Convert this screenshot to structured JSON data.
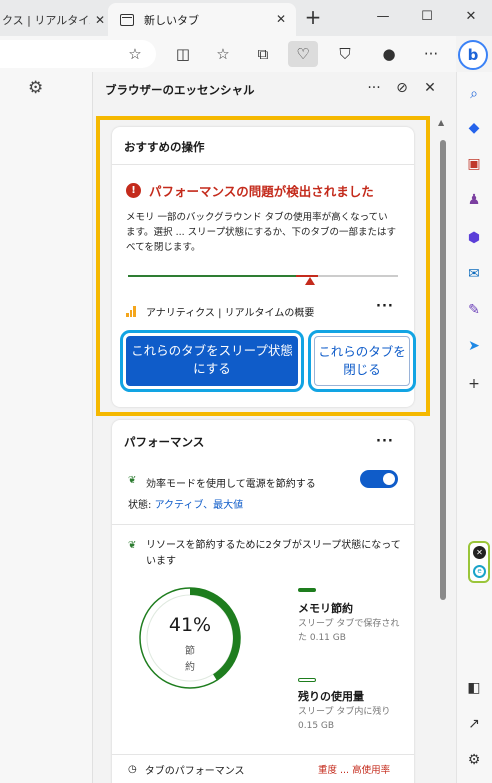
{
  "tabs": {
    "inactive_title": "クス | リアルタイムの",
    "active_title": "新しいタブ",
    "close_glyph": "✕",
    "new_tab_glyph": "+"
  },
  "window_controls": {
    "minimize": "—",
    "maximize": "☐",
    "close": "✕"
  },
  "panel": {
    "title": "ブラウザーのエッセンシャル",
    "more_glyph": "···",
    "pin_glyph": "⊘",
    "close_glyph": "✕"
  },
  "recommended": {
    "title": "おすすめの操作",
    "alert_glyph": "!",
    "alert_title": "パフォーマンスの問題が検出されました",
    "description": "メモリ 一部のバックグラウンド タブの使用率が高くなっています。選択 ... スリープ状態にするか、下のタブの一部またはすべてを閉じます。",
    "tab_name": "アナリティクス | リアルタイムの概要",
    "more_glyph": "···",
    "sleep_button": "これらのタブをスリープ状態にする",
    "close_button": "これらのタブを閉じる"
  },
  "performance": {
    "title": "パフォーマンス",
    "more_glyph": "···",
    "efficiency_label": "効率モードを使用して電源を節約する",
    "status_prefix": "状態: ",
    "status_value": "アクティブ、最大値",
    "efficiency_on": true,
    "sleep_info": "リソースを節約するために2タブがスリープ状態になっています",
    "donut_percent": "41%",
    "donut_value": 41,
    "donut_label_1": "節",
    "donut_label_2": "約",
    "memory_saved_title": "メモリ節約",
    "memory_saved_desc": "スリープ タブで保存された 0.11 GB",
    "remaining_title": "残りの使用量",
    "remaining_desc": "スリープ タブ内に残り 0.15 GB",
    "bottom_label": "タブのパフォーマンス",
    "bottom_right": "重度 ... 高使用率"
  },
  "colors": {
    "accent": "#0f5cc9",
    "alert": "#c42b1c",
    "saving_green": "#1e7d1e",
    "highlight": "#f5b800",
    "button_outline": "#12a4e3"
  }
}
